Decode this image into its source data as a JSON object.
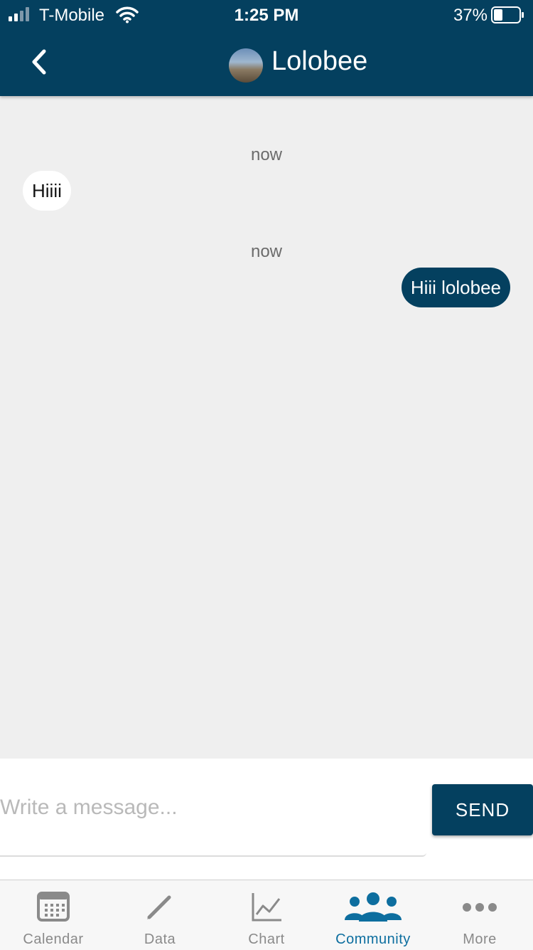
{
  "status_bar": {
    "carrier": "T-Mobile",
    "time": "1:25 PM",
    "battery": "37%"
  },
  "nav": {
    "title": "Lolobee"
  },
  "messages": [
    {
      "timestamp": "now",
      "text": "Hiiii",
      "direction": "incoming"
    },
    {
      "timestamp": "now",
      "text": "Hiii lolobee",
      "direction": "outgoing"
    }
  ],
  "composer": {
    "placeholder": "Write a message...",
    "send_label": "SEND"
  },
  "tabs": [
    {
      "label": "Calendar",
      "icon": "calendar-icon",
      "active": false
    },
    {
      "label": "Data",
      "icon": "pencil-icon",
      "active": false
    },
    {
      "label": "Chart",
      "icon": "line-chart-icon",
      "active": false
    },
    {
      "label": "Community",
      "icon": "people-icon",
      "active": true
    },
    {
      "label": "More",
      "icon": "more-dots-icon",
      "active": false
    }
  ],
  "colors": {
    "primary": "#04405f",
    "active_tab": "#0d6e9f",
    "background": "#efefef"
  }
}
